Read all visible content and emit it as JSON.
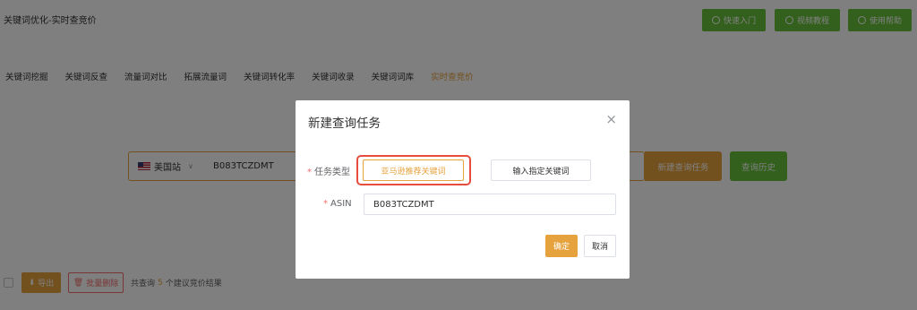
{
  "header": {
    "title": "关键词优化-实时查竞价",
    "buttons": [
      {
        "label": "快速入门"
      },
      {
        "label": "视频教程"
      },
      {
        "label": "使用帮助"
      }
    ]
  },
  "tabs": [
    {
      "label": "关键词挖掘"
    },
    {
      "label": "关键词反查"
    },
    {
      "label": "流量词对比"
    },
    {
      "label": "拓展流量词"
    },
    {
      "label": "关键词转化率"
    },
    {
      "label": "关键词收录"
    },
    {
      "label": "关键词词库"
    },
    {
      "label": "实时查竞价",
      "active": true
    }
  ],
  "search": {
    "site": "美国站",
    "value": "B083TCZDMT",
    "new_query_label": "新建查询任务",
    "history_label": "查询历史"
  },
  "bottom": {
    "export_label": "导出",
    "batch_delete_label": "批量删除",
    "summary_prefix": "共查询",
    "summary_count": "5",
    "summary_suffix": "个建议竞价结果"
  },
  "dialog": {
    "title": "新建查询任务",
    "close_glyph": "×",
    "task_type_label": "任务类型",
    "option_amazon": "亚马逊推荐关键词",
    "option_custom": "输入指定关键词",
    "asin_label": "ASIN",
    "asin_value": "B083TCZDMT",
    "confirm_label": "确定",
    "cancel_label": "取消",
    "required_mark": "*"
  },
  "colors": {
    "accent": "#e6a23c",
    "success": "#67c23a",
    "danger": "#f56c6c",
    "highlight": "#e74c3c"
  }
}
